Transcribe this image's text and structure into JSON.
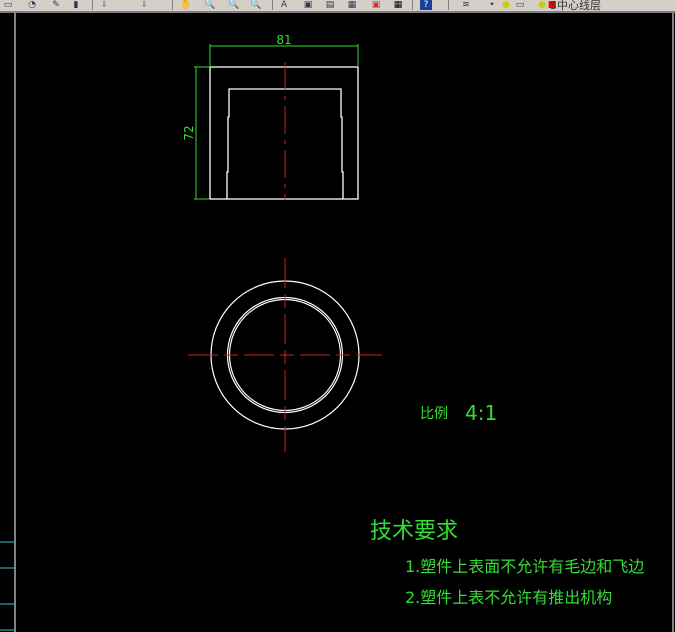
{
  "toolbar": {
    "icons": [
      "new-icon",
      "open-icon",
      "brush-icon",
      "paste-icon",
      "undo-icon",
      "redo-icon",
      "pan-icon",
      "zoom-realtime-icon",
      "zoom-window-icon",
      "zoom-previous-icon",
      "text-style-icon",
      "properties-icon",
      "design-center-icon",
      "tool-palette-icon",
      "markup-icon",
      "table-icon",
      "help-icon",
      "layers-icon",
      "bulb-icon",
      "sun-icon",
      "lock-icon",
      "color-swatch-icon"
    ],
    "current_layer": "3中心线层",
    "layer_color": "#ee0000"
  },
  "drawing": {
    "dim_width": "81",
    "dim_height": "72",
    "scale_label": "比例",
    "scale_value": "4:1",
    "tech_title": "技术要求",
    "notes": [
      "1.塑件上表面不允许有毛边和飞边",
      "2.塑件上表不允许有推出机构"
    ],
    "colors": {
      "outline": "#ffffff",
      "centerline": "#cc2222",
      "dimension": "#33dd33",
      "frame": "#40c0c0"
    }
  }
}
